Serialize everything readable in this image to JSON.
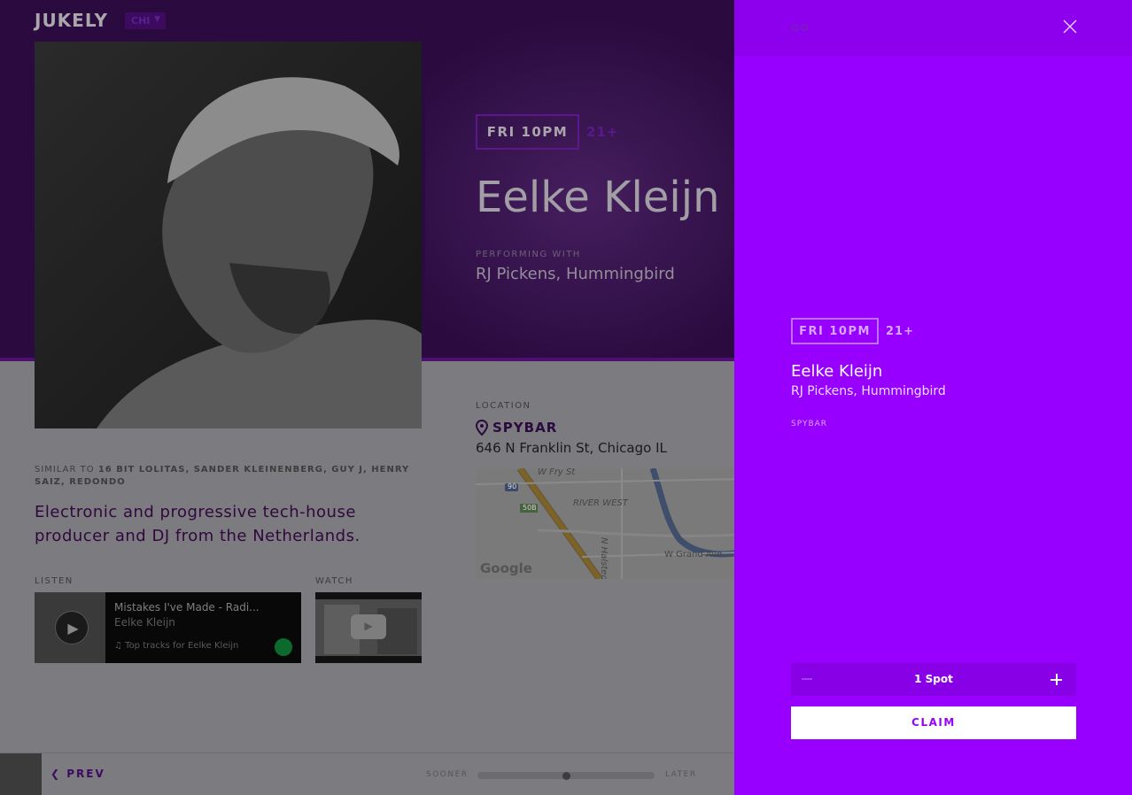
{
  "header": {
    "logo": "JUKELY",
    "city": "CHI"
  },
  "event": {
    "time": "FRI 10PM",
    "age": "21+",
    "artist": "Eelke Kleijn",
    "performing_with_label": "PERFORMING WITH",
    "performing_with": "RJ Pickens, Hummingbird",
    "similar_to_label": "SIMILAR TO",
    "similar_to": "16 BIT LOLITAS, SANDER KLEINENBERG, GUY J, HENRY SAIZ, REDONDO",
    "bio": "Electronic and progressive tech-house producer and DJ from the Netherlands."
  },
  "listen": {
    "label": "LISTEN",
    "track": "Mistakes I've Made - Radi...",
    "artist": "Eelke Kleijn",
    "meta": "Top tracks for Eelke Kleijn"
  },
  "watch": {
    "label": "WATCH"
  },
  "location": {
    "label": "LOCATION",
    "venue": "SPYBAR",
    "address": "646 N Franklin St, Chicago IL",
    "map_labels": {
      "street1": "W Fry St",
      "area": "RIVER WEST",
      "street2": "N Halsted St",
      "street3": "W Grand Ave",
      "hwy": "90",
      "exit": "50B",
      "brand": "Google"
    }
  },
  "bottom_bar": {
    "prev": "PREV",
    "sooner": "SOONER",
    "later": "LATER",
    "timeline_position": 0.5
  },
  "panel": {
    "go": "GO",
    "time": "FRI 10PM",
    "age": "21+",
    "artist": "Eelke Kleijn",
    "with": "RJ Pickens, Hummingbird",
    "venue": "SPYBAR",
    "spots": "1 Spot",
    "claim": "CLAIM"
  },
  "colors": {
    "panel": "#9700ff",
    "hero": "#2a0a3f",
    "accent": "#5b1690"
  }
}
